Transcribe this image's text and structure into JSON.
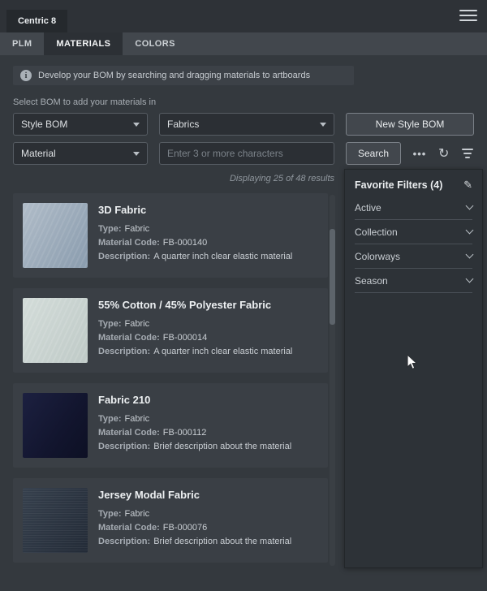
{
  "app": {
    "title": "Centric 8"
  },
  "tabs": [
    {
      "label": "PLM",
      "active": false
    },
    {
      "label": "MATERIALS",
      "active": true
    },
    {
      "label": "COLORS",
      "active": false
    }
  ],
  "banner": {
    "text": "Develop your BOM by searching and dragging materials to artboards"
  },
  "controls": {
    "section_label": "Select BOM to add your materials in",
    "bom_select_value": "Style BOM",
    "category_select_value": "Fabrics",
    "new_bom_button": "New Style BOM",
    "type_select_value": "Material",
    "search_placeholder": "Enter 3 or more characters",
    "search_button": "Search"
  },
  "icons": {
    "info": "i",
    "more": "•••",
    "refresh": "↻",
    "edit": "✎"
  },
  "results_text": "Displaying 25 of 48 results",
  "filters": {
    "title": "Favorite Filters (4)",
    "sections": [
      {
        "label": "Active"
      },
      {
        "label": "Collection"
      },
      {
        "label": "Colorways"
      },
      {
        "label": "Season"
      }
    ]
  },
  "card_labels": {
    "type": "Type:",
    "code": "Material Code:",
    "description": "Description:"
  },
  "materials": [
    {
      "name": "3D Fabric",
      "type": "Fabric",
      "code": "FB-000140",
      "description": "A quarter inch clear elastic material",
      "swatch": "repeating-linear-gradient(115deg, rgba(255,255,255,0.08) 0px, rgba(255,255,255,0.08) 2px, transparent 2px, transparent 6px), linear-gradient(125deg,#b0bcc8,#8a9cae)"
    },
    {
      "name": "55% Cotton / 45% Polyester Fabric",
      "type": "Fabric",
      "code": "FB-000014",
      "description": "A quarter inch clear elastic material",
      "swatch": "repeating-linear-gradient(115deg, rgba(255,255,255,0.10) 0px, rgba(255,255,255,0.10) 2px, transparent 2px, transparent 6px), linear-gradient(125deg,#d3dcd9,#bfcac7)"
    },
    {
      "name": "Fabric 210",
      "type": "Fabric",
      "code": "FB-000112",
      "description": "Brief description about the material",
      "swatch": "linear-gradient(125deg,#1c2040 0%,#12152e 60%,#0d1024 100%)"
    },
    {
      "name": "Jersey Modal Fabric",
      "type": "Fabric",
      "code": "FB-000076",
      "description": "Brief description about the material",
      "swatch": "repeating-linear-gradient(0deg, rgba(255,255,255,0.05) 0px, rgba(255,255,255,0.05) 1px, transparent 1px, transparent 3px), linear-gradient(125deg,#36404d,#232b37)"
    }
  ],
  "colors": {
    "background": "#34393e",
    "card": "#3a3f45",
    "panel": "#2d3237",
    "tab_strip": "#42474d"
  }
}
